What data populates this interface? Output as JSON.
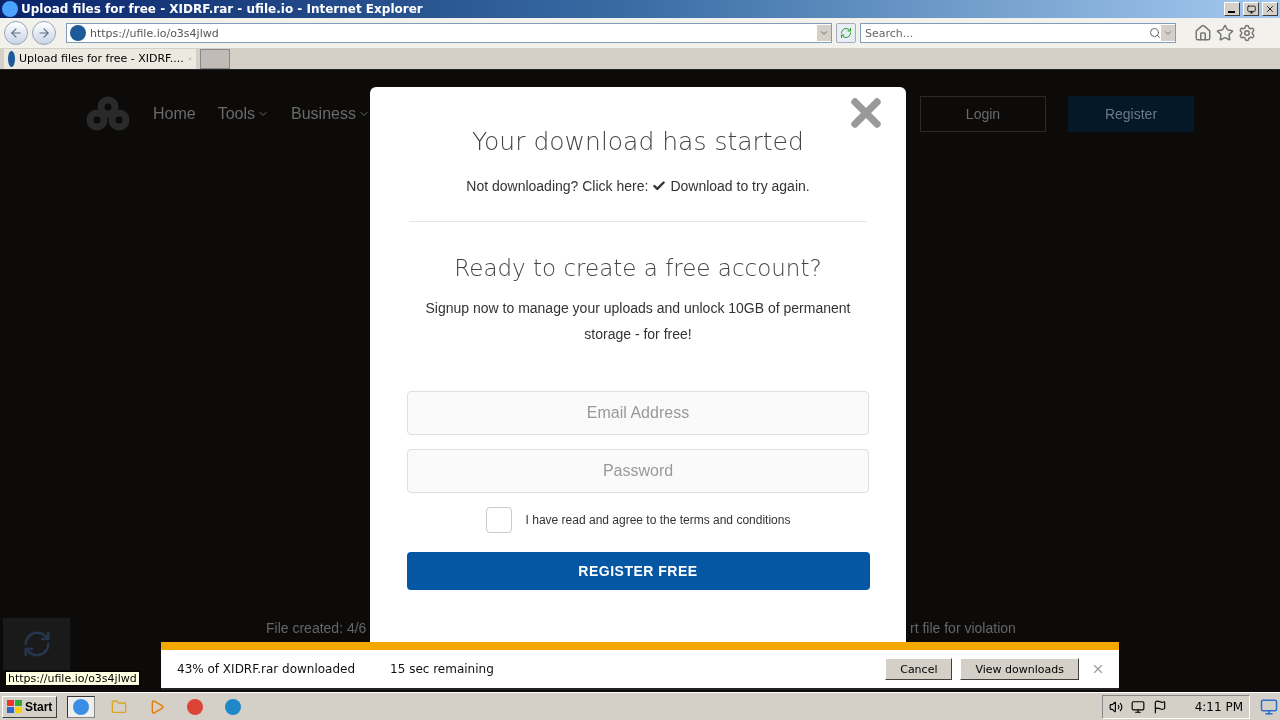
{
  "window": {
    "title": "Upload files for free - XIDRF.rar - ufile.io - Internet Explorer"
  },
  "browser": {
    "address": "https://ufile.io/o3s4jlwd",
    "search": {
      "placeholder": "Search..."
    },
    "tabs": [
      {
        "title": "Upload files for free - XIDRF....",
        "selected": true
      }
    ]
  },
  "site": {
    "nav": [
      {
        "label": "Home",
        "has_menu": false
      },
      {
        "label": "Tools",
        "has_menu": true
      },
      {
        "label": "Business",
        "has_menu": true
      }
    ],
    "login": "Login",
    "register": "Register",
    "footer_left": "File created: 4/6",
    "footer_right": "rt file for violation"
  },
  "modal": {
    "title": "Your download has started",
    "retry_prefix": "Not downloading? Click here:",
    "retry_link": "Download to try again.",
    "heading": "Ready to create a free account?",
    "description": "Signup now to manage your uploads and unlock 10GB of permanent storage - for free!",
    "email": {
      "placeholder": "Email Address"
    },
    "password": {
      "placeholder": "Password"
    },
    "terms": {
      "label": "I have read and agree to the terms and conditions",
      "checked": false
    },
    "submit": "REGISTER FREE"
  },
  "status_tooltip": "https://ufile.io/o3s4jlwd",
  "download_bar": {
    "status": "43% of XIDRF.rar downloaded",
    "remaining": "15 sec remaining",
    "buttons": [
      "Cancel",
      "View downloads"
    ]
  },
  "taskbar": {
    "start": "Start",
    "clock": "4:11 PM"
  }
}
